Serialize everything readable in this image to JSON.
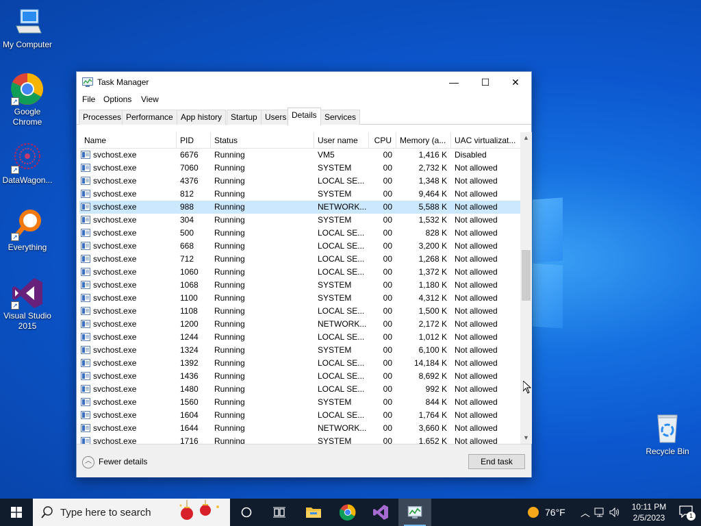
{
  "desktop": {
    "icons": [
      {
        "label": "My Computer"
      },
      {
        "label": "Google Chrome"
      },
      {
        "label": "DataWagon..."
      },
      {
        "label": "Everything"
      },
      {
        "label": "Visual Studio 2015"
      },
      {
        "label": "Recycle Bin"
      }
    ]
  },
  "window": {
    "title": "Task Manager",
    "minimize": "—",
    "maximize": "☐",
    "close": "✕",
    "menu": [
      "File",
      "Options",
      "View"
    ],
    "tabs": [
      "Processes",
      "Performance",
      "App history",
      "Startup",
      "Users",
      "Details",
      "Services"
    ],
    "active_tab": "Details",
    "columns": [
      "Name",
      "PID",
      "Status",
      "User name",
      "CPU",
      "Memory (a...",
      "UAC virtualizat..."
    ],
    "rows": [
      {
        "name": "svchost.exe",
        "pid": "6676",
        "status": "Running",
        "user": "VM5",
        "cpu": "00",
        "mem": "1,416 K",
        "uac": "Disabled"
      },
      {
        "name": "svchost.exe",
        "pid": "7060",
        "status": "Running",
        "user": "SYSTEM",
        "cpu": "00",
        "mem": "2,732 K",
        "uac": "Not allowed"
      },
      {
        "name": "svchost.exe",
        "pid": "4376",
        "status": "Running",
        "user": "LOCAL SE...",
        "cpu": "00",
        "mem": "1,348 K",
        "uac": "Not allowed"
      },
      {
        "name": "svchost.exe",
        "pid": "812",
        "status": "Running",
        "user": "SYSTEM",
        "cpu": "00",
        "mem": "9,464 K",
        "uac": "Not allowed"
      },
      {
        "name": "svchost.exe",
        "pid": "988",
        "status": "Running",
        "user": "NETWORK...",
        "cpu": "00",
        "mem": "5,588 K",
        "uac": "Not allowed",
        "selected": true
      },
      {
        "name": "svchost.exe",
        "pid": "304",
        "status": "Running",
        "user": "SYSTEM",
        "cpu": "00",
        "mem": "1,532 K",
        "uac": "Not allowed"
      },
      {
        "name": "svchost.exe",
        "pid": "500",
        "status": "Running",
        "user": "LOCAL SE...",
        "cpu": "00",
        "mem": "828 K",
        "uac": "Not allowed"
      },
      {
        "name": "svchost.exe",
        "pid": "668",
        "status": "Running",
        "user": "LOCAL SE...",
        "cpu": "00",
        "mem": "3,200 K",
        "uac": "Not allowed"
      },
      {
        "name": "svchost.exe",
        "pid": "712",
        "status": "Running",
        "user": "LOCAL SE...",
        "cpu": "00",
        "mem": "1,268 K",
        "uac": "Not allowed"
      },
      {
        "name": "svchost.exe",
        "pid": "1060",
        "status": "Running",
        "user": "LOCAL SE...",
        "cpu": "00",
        "mem": "1,372 K",
        "uac": "Not allowed"
      },
      {
        "name": "svchost.exe",
        "pid": "1068",
        "status": "Running",
        "user": "SYSTEM",
        "cpu": "00",
        "mem": "1,180 K",
        "uac": "Not allowed"
      },
      {
        "name": "svchost.exe",
        "pid": "1100",
        "status": "Running",
        "user": "SYSTEM",
        "cpu": "00",
        "mem": "4,312 K",
        "uac": "Not allowed"
      },
      {
        "name": "svchost.exe",
        "pid": "1108",
        "status": "Running",
        "user": "LOCAL SE...",
        "cpu": "00",
        "mem": "1,500 K",
        "uac": "Not allowed"
      },
      {
        "name": "svchost.exe",
        "pid": "1200",
        "status": "Running",
        "user": "NETWORK...",
        "cpu": "00",
        "mem": "2,172 K",
        "uac": "Not allowed"
      },
      {
        "name": "svchost.exe",
        "pid": "1244",
        "status": "Running",
        "user": "LOCAL SE...",
        "cpu": "00",
        "mem": "1,012 K",
        "uac": "Not allowed"
      },
      {
        "name": "svchost.exe",
        "pid": "1324",
        "status": "Running",
        "user": "SYSTEM",
        "cpu": "00",
        "mem": "6,100 K",
        "uac": "Not allowed"
      },
      {
        "name": "svchost.exe",
        "pid": "1392",
        "status": "Running",
        "user": "LOCAL SE...",
        "cpu": "00",
        "mem": "14,184 K",
        "uac": "Not allowed"
      },
      {
        "name": "svchost.exe",
        "pid": "1436",
        "status": "Running",
        "user": "LOCAL SE...",
        "cpu": "00",
        "mem": "8,692 K",
        "uac": "Not allowed"
      },
      {
        "name": "svchost.exe",
        "pid": "1480",
        "status": "Running",
        "user": "LOCAL SE...",
        "cpu": "00",
        "mem": "992 K",
        "uac": "Not allowed"
      },
      {
        "name": "svchost.exe",
        "pid": "1560",
        "status": "Running",
        "user": "SYSTEM",
        "cpu": "00",
        "mem": "844 K",
        "uac": "Not allowed"
      },
      {
        "name": "svchost.exe",
        "pid": "1604",
        "status": "Running",
        "user": "LOCAL SE...",
        "cpu": "00",
        "mem": "1,764 K",
        "uac": "Not allowed"
      },
      {
        "name": "svchost.exe",
        "pid": "1644",
        "status": "Running",
        "user": "NETWORK...",
        "cpu": "00",
        "mem": "3,660 K",
        "uac": "Not allowed"
      },
      {
        "name": "svchost.exe",
        "pid": "1716",
        "status": "Running",
        "user": "SYSTEM",
        "cpu": "00",
        "mem": "1,652 K",
        "uac": "Not allowed"
      }
    ],
    "fewer_details": "Fewer details",
    "end_task": "End task"
  },
  "taskbar": {
    "search_placeholder": "Type here to search",
    "weather_temp": "76°F",
    "time": "10:11 PM",
    "date": "2/5/2023",
    "notification_count": "1"
  },
  "colors": {
    "selected_row": "#cce8ff",
    "taskbar": "#101b2b",
    "accent": "#0078d7"
  }
}
